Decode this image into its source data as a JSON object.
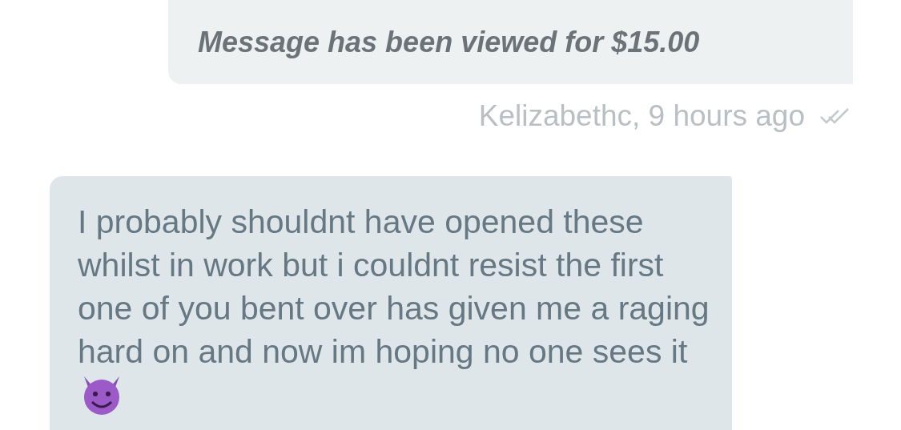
{
  "messages": [
    {
      "kind": "outgoing",
      "text": "Message has been viewed for $15.00",
      "meta": "Kelizabethc, 9 hours ago",
      "read": true
    },
    {
      "kind": "incoming",
      "text": "I probably shouldnt have opened these whilst in work but i couldnt resist the first one of you bent over has given me a raging hard on and now im hoping no one sees it",
      "emoji": true
    }
  ]
}
